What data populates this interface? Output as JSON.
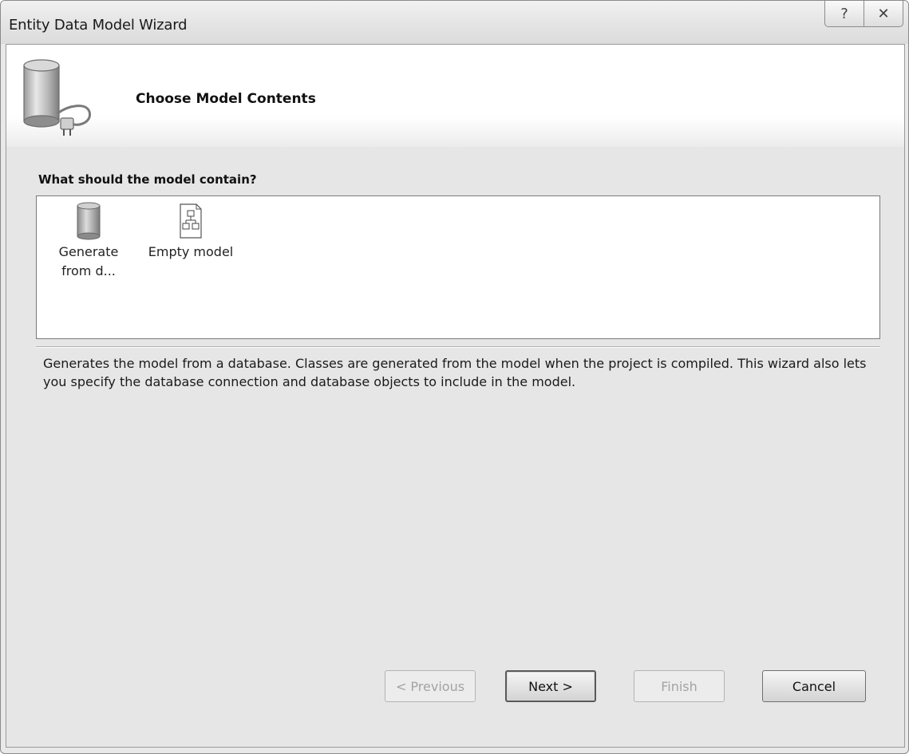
{
  "window": {
    "title": "Entity Data Model Wizard",
    "help_glyph": "?",
    "close_glyph": "✕"
  },
  "header": {
    "title": "Choose Model Contents"
  },
  "prompt": {
    "label": "What should the model contain?"
  },
  "options": [
    {
      "label_line1": "Generate",
      "label_line2": "from d...",
      "icon": "database-icon",
      "selected": true
    },
    {
      "label_line1": "Empty model",
      "label_line2": "",
      "icon": "empty-model-icon",
      "selected": false
    }
  ],
  "description": "Generates the model from a database. Classes are generated from the model when the project is compiled. This wizard also lets you specify the database connection and database objects to include in the model.",
  "buttons": {
    "previous": "< Previous",
    "next": "Next >",
    "finish": "Finish",
    "cancel": "Cancel"
  },
  "button_states": {
    "previous": "disabled",
    "next": "default",
    "finish": "disabled",
    "cancel": "enabled"
  }
}
